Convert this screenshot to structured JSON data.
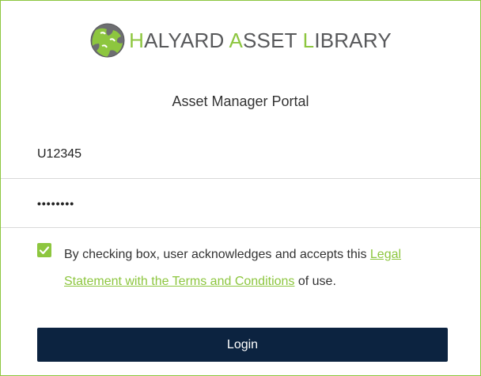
{
  "logo": {
    "icon": "puzzle-globe-icon",
    "text_part1_accent": "H",
    "text_part2": "ALYARD ",
    "text_part3_accent": "A",
    "text_part4": "SSET ",
    "text_part5_accent": "L",
    "text_part6": "IBRARY"
  },
  "portal_title": "Asset Manager Portal",
  "username": {
    "value": "U12345"
  },
  "password": {
    "value": "••••••••"
  },
  "terms": {
    "checked": true,
    "text_before": "By checking box, user acknowledges and accepts this ",
    "link_text": "Legal Statement with the Terms and Conditions",
    "text_after": " of use."
  },
  "login_button": {
    "label": "Login"
  },
  "colors": {
    "accent": "#8dc63f",
    "button": "#0c2340",
    "logo_gray": "#58595b",
    "border": "#8dc63f"
  }
}
